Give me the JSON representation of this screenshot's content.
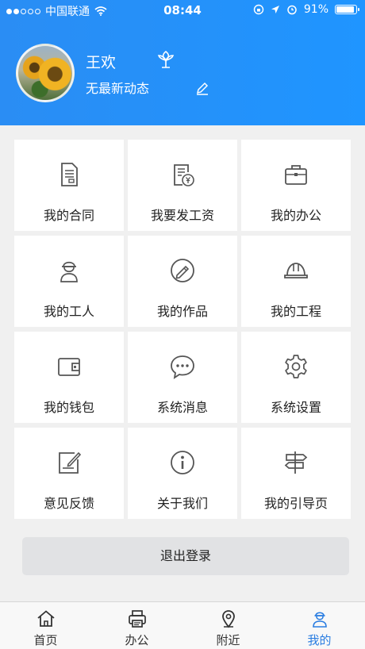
{
  "status_bar": {
    "carrier": "中国联通",
    "time": "08:44",
    "battery": "91%",
    "battery_level": 0.91,
    "icons": [
      "signal-dots-icon",
      "wifi-icon",
      "rotation-lock-icon",
      "location-icon",
      "alarm-icon",
      "battery-icon"
    ]
  },
  "profile": {
    "name": "王欢",
    "status": "无最新动态",
    "icons": [
      "avatar",
      "flower-icon",
      "edit-icon"
    ]
  },
  "menu": [
    {
      "id": "contract",
      "label": "我的合同",
      "icon": "contract-document-icon"
    },
    {
      "id": "salary",
      "label": "我要发工资",
      "icon": "salary-document-icon"
    },
    {
      "id": "office",
      "label": "我的办公",
      "icon": "briefcase-icon"
    },
    {
      "id": "workers",
      "label": "我的工人",
      "icon": "worker-icon"
    },
    {
      "id": "works",
      "label": "我的作品",
      "icon": "pencil-circle-icon"
    },
    {
      "id": "project",
      "label": "我的工程",
      "icon": "hard-hat-icon"
    },
    {
      "id": "wallet",
      "label": "我的钱包",
      "icon": "wallet-icon"
    },
    {
      "id": "messages",
      "label": "系统消息",
      "icon": "chat-bubble-icon"
    },
    {
      "id": "settings",
      "label": "系统设置",
      "icon": "gear-icon"
    },
    {
      "id": "feedback",
      "label": "意见反馈",
      "icon": "feedback-edit-icon"
    },
    {
      "id": "about",
      "label": "关于我们",
      "icon": "info-icon"
    },
    {
      "id": "guide",
      "label": "我的引导页",
      "icon": "signpost-icon"
    }
  ],
  "logout_label": "退出登录",
  "tabs": [
    {
      "label": "首页",
      "icon": "home-icon"
    },
    {
      "label": "办公",
      "icon": "printer-icon"
    },
    {
      "label": "附近",
      "icon": "location-pin-icon"
    },
    {
      "label": "我的",
      "icon": "worker-profile-icon"
    }
  ],
  "active_tab": "我的",
  "colors": {
    "header": "#2a8df4",
    "active_tab": "#2a7de1",
    "icon_gray": "#555555"
  }
}
